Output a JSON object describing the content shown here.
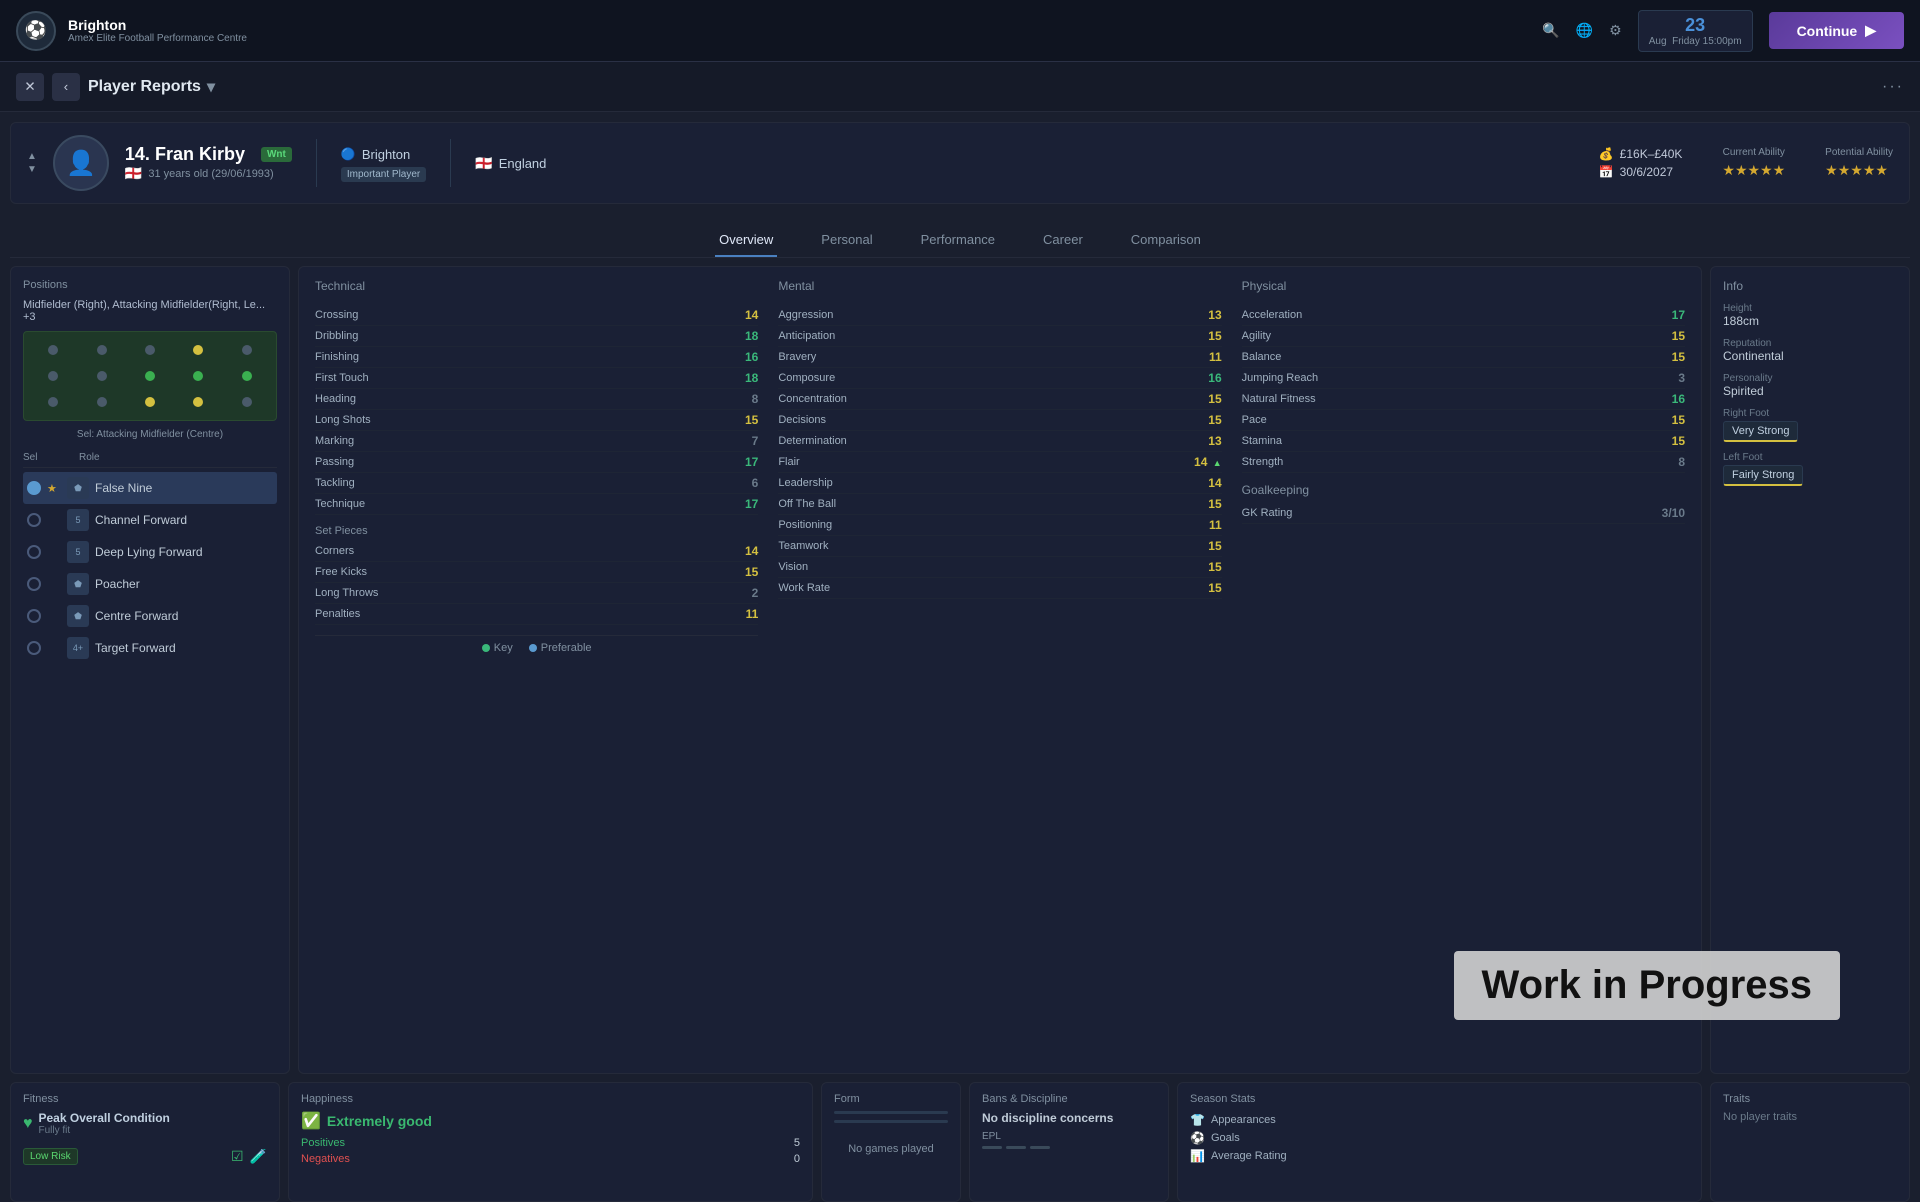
{
  "topbar": {
    "club_name": "Brighton",
    "club_sub": "Amex Elite Football Performance Centre",
    "date_num": "23",
    "date_day": "Aug",
    "date_time": "Friday\n15:00pm",
    "continue_label": "Continue"
  },
  "navbar": {
    "title": "Player Reports",
    "more_icon": "···"
  },
  "player": {
    "number": "14.",
    "name": "Fran Kirby",
    "age": "31 years old (29/06/1993)",
    "badge": "Wnt",
    "club": "Brighton",
    "country": "England",
    "status": "Important Player",
    "wage": "£16K–£40K",
    "contract_end": "30/6/2027",
    "current_ability_label": "Current Ability",
    "potential_ability_label": "Potential Ability",
    "current_stars": 5,
    "potential_stars": 5
  },
  "tabs": {
    "items": [
      "Overview",
      "Personal",
      "Performance",
      "Career",
      "Comparison"
    ],
    "active": "Overview"
  },
  "positions": {
    "label": "Positions",
    "value": "Midfielder (Right), Attacking Midfielder(Right, Le... +3"
  },
  "pitch_sel": "Sel: Attacking Midfielder (Centre)",
  "roles": {
    "headers": [
      "Sel",
      "",
      "Role"
    ],
    "items": [
      {
        "selected": true,
        "star": true,
        "name": "False Nine"
      },
      {
        "selected": false,
        "star": false,
        "name": "Channel Forward"
      },
      {
        "selected": false,
        "star": false,
        "name": "Deep Lying Forward"
      },
      {
        "selected": false,
        "star": false,
        "name": "Poacher"
      },
      {
        "selected": false,
        "star": false,
        "name": "Centre Forward"
      },
      {
        "selected": false,
        "star": false,
        "name": "Target Forward"
      }
    ]
  },
  "technical": {
    "title": "Technical",
    "stats": [
      {
        "name": "Crossing",
        "val": "14",
        "color": "yellow"
      },
      {
        "name": "Dribbling",
        "val": "18",
        "color": "green"
      },
      {
        "name": "Finishing",
        "val": "16",
        "color": "green"
      },
      {
        "name": "First Touch",
        "val": "18",
        "color": "green"
      },
      {
        "name": "Heading",
        "val": "8",
        "color": "dimmed"
      },
      {
        "name": "Long Shots",
        "val": "15",
        "color": "yellow"
      },
      {
        "name": "Marking",
        "val": "7",
        "color": "dimmed"
      },
      {
        "name": "Passing",
        "val": "17",
        "color": "green"
      },
      {
        "name": "Tackling",
        "val": "6",
        "color": "dimmed"
      },
      {
        "name": "Technique",
        "val": "17",
        "color": "green"
      }
    ],
    "set_pieces_title": "Set Pieces",
    "set_pieces": [
      {
        "name": "Corners",
        "val": "14",
        "color": "yellow"
      },
      {
        "name": "Free Kicks",
        "val": "15",
        "color": "yellow"
      },
      {
        "name": "Long Throws",
        "val": "2",
        "color": "dimmed"
      },
      {
        "name": "Penalties",
        "val": "11",
        "color": "yellow"
      }
    ]
  },
  "mental": {
    "title": "Mental",
    "stats": [
      {
        "name": "Aggression",
        "val": "13",
        "color": "yellow"
      },
      {
        "name": "Anticipation",
        "val": "15",
        "color": "yellow"
      },
      {
        "name": "Bravery",
        "val": "11",
        "color": "yellow"
      },
      {
        "name": "Composure",
        "val": "16",
        "color": "green"
      },
      {
        "name": "Concentration",
        "val": "15",
        "color": "yellow"
      },
      {
        "name": "Decisions",
        "val": "15",
        "color": "yellow"
      },
      {
        "name": "Determination",
        "val": "13",
        "color": "yellow"
      },
      {
        "name": "Flair",
        "val": "14",
        "color": "yellow",
        "arrow": true
      },
      {
        "name": "Leadership",
        "val": "14",
        "color": "yellow"
      },
      {
        "name": "Off The Ball",
        "val": "15",
        "color": "yellow"
      },
      {
        "name": "Positioning",
        "val": "11",
        "color": "yellow"
      },
      {
        "name": "Teamwork",
        "val": "15",
        "color": "yellow"
      },
      {
        "name": "Vision",
        "val": "15",
        "color": "yellow"
      },
      {
        "name": "Work Rate",
        "val": "15",
        "color": "yellow"
      }
    ]
  },
  "physical": {
    "title": "Physical",
    "stats": [
      {
        "name": "Acceleration",
        "val": "17",
        "color": "green"
      },
      {
        "name": "Agility",
        "val": "15",
        "color": "yellow"
      },
      {
        "name": "Balance",
        "val": "15",
        "color": "yellow"
      },
      {
        "name": "Jumping Reach",
        "val": "3",
        "color": "dimmed"
      },
      {
        "name": "Natural Fitness",
        "val": "16",
        "color": "green"
      },
      {
        "name": "Pace",
        "val": "15",
        "color": "yellow"
      },
      {
        "name": "Stamina",
        "val": "15",
        "color": "yellow"
      },
      {
        "name": "Strength",
        "val": "8",
        "color": "dimmed"
      }
    ],
    "goalkeeping_title": "Goalkeeping",
    "goalkeeping": [
      {
        "name": "GK Rating",
        "val": "3/10",
        "color": "dimmed"
      }
    ]
  },
  "info": {
    "title": "Info",
    "height_label": "Height",
    "height_val": "188cm",
    "reputation_label": "Reputation",
    "reputation_val": "Continental",
    "personality_label": "Personality",
    "personality_val": "Spirited",
    "right_foot_label": "Right Foot",
    "right_foot_val": "Very Strong",
    "left_foot_label": "Left Foot",
    "left_foot_val": "Fairly Strong"
  },
  "legend": {
    "key_label": "Key",
    "preferable_label": "Preferable"
  },
  "fitness": {
    "title": "Fitness",
    "peak_label": "Peak Overall Condition",
    "peak_sub": "Fully fit",
    "risk_label": "Low Risk"
  },
  "happiness": {
    "title": "Happiness",
    "status": "Extremely good",
    "positives_label": "Positives",
    "positives_val": "5",
    "negatives_label": "Negatives",
    "negatives_val": "0"
  },
  "form": {
    "title": "Form",
    "no_games": "No games played"
  },
  "bans": {
    "title": "Bans & Discipline",
    "status": "No discipline concerns",
    "league": "EPL"
  },
  "season": {
    "title": "Season Stats",
    "stats": [
      {
        "icon": "shirt",
        "name": "Appearances"
      },
      {
        "icon": "goal",
        "name": "Goals"
      },
      {
        "icon": "chart",
        "name": "Average Rating"
      }
    ]
  },
  "traits": {
    "title": "Traits",
    "no_traits": "No player traits"
  },
  "wip": "Work in Progress"
}
